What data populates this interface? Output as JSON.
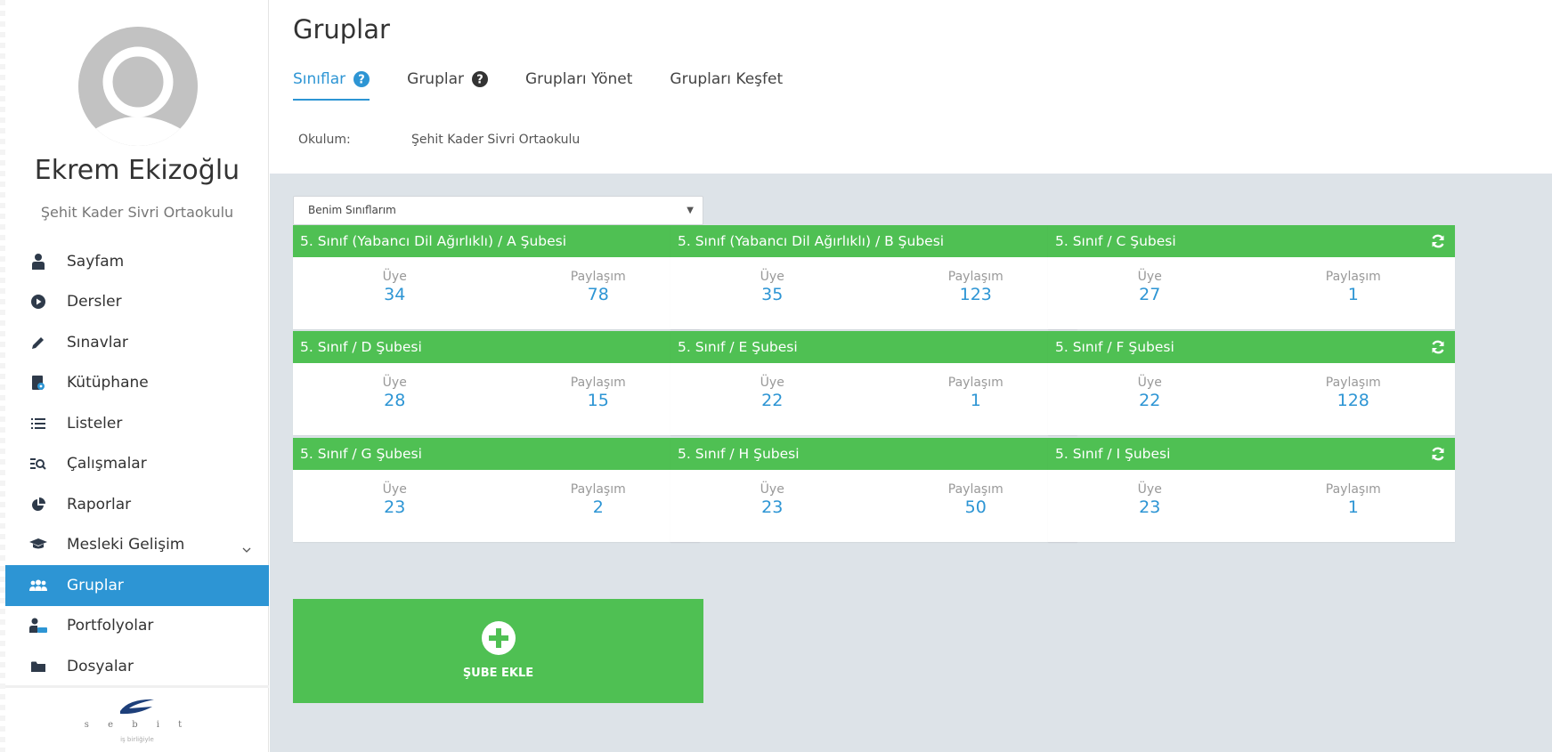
{
  "user": {
    "name": "Ekrem Ekizoğlu",
    "school": "Şehit Kader Sivri Ortaokulu"
  },
  "sidebar": {
    "items": [
      {
        "label": "Sayfam",
        "icon": "user-icon"
      },
      {
        "label": "Dersler",
        "icon": "play-circle-icon"
      },
      {
        "label": "Sınavlar",
        "icon": "pencil-icon"
      },
      {
        "label": "Kütüphane",
        "icon": "book-icon"
      },
      {
        "label": "Listeler",
        "icon": "list-icon"
      },
      {
        "label": "Çalışmalar",
        "icon": "search-list-icon"
      },
      {
        "label": "Raporlar",
        "icon": "pie-chart-icon"
      },
      {
        "label": "Mesleki Gelişim",
        "icon": "graduation-cap-icon"
      },
      {
        "label": "Gruplar",
        "icon": "users-icon",
        "active": true
      },
      {
        "label": "Portfolyolar",
        "icon": "user-folder-icon"
      },
      {
        "label": "Dosyalar",
        "icon": "folder-icon"
      }
    ],
    "footer": {
      "logo_letters": "s e b i t",
      "tagline": "iş birliğiyle"
    }
  },
  "header": {
    "title": "Gruplar",
    "tabs": [
      {
        "label": "Sınıflar",
        "active": true,
        "help": true
      },
      {
        "label": "Gruplar",
        "active": false,
        "help": true
      },
      {
        "label": "Grupları Yönet",
        "active": false,
        "help": false
      },
      {
        "label": "Grupları Keşfet",
        "active": false,
        "help": false
      }
    ],
    "school_label": "Okulum:",
    "school_value": "Şehit Kader Sivri Ortaokulu"
  },
  "main": {
    "class_filter": {
      "selected": "Benim Sınıflarım",
      "caret": "▼"
    },
    "member_label": "Üye",
    "share_label": "Paylaşım",
    "cards": [
      {
        "title": "5. Sınıf (Yabancı Dil Ağırlıklı) / A Şubesi",
        "members": "34",
        "shares": "78"
      },
      {
        "title": "5. Sınıf (Yabancı Dil Ağırlıklı) / B Şubesi",
        "members": "35",
        "shares": "123"
      },
      {
        "title": "5. Sınıf / C Şubesi",
        "members": "27",
        "shares": "1"
      },
      {
        "title": "5. Sınıf / D Şubesi",
        "members": "28",
        "shares": "15"
      },
      {
        "title": "5. Sınıf / E Şubesi",
        "members": "22",
        "shares": "1"
      },
      {
        "title": "5. Sınıf / F Şubesi",
        "members": "22",
        "shares": "128"
      },
      {
        "title": "5. Sınıf / G Şubesi",
        "members": "23",
        "shares": "2"
      },
      {
        "title": "5. Sınıf / H Şubesi",
        "members": "23",
        "shares": "50"
      },
      {
        "title": "5. Sınıf / I Şubesi",
        "members": "23",
        "shares": "1"
      }
    ],
    "add_branch_label": "ŞUBE EKLE"
  },
  "colors": {
    "accent": "#2d95d4",
    "card_header": "#4fc053",
    "main_bg": "#dde3e8"
  }
}
